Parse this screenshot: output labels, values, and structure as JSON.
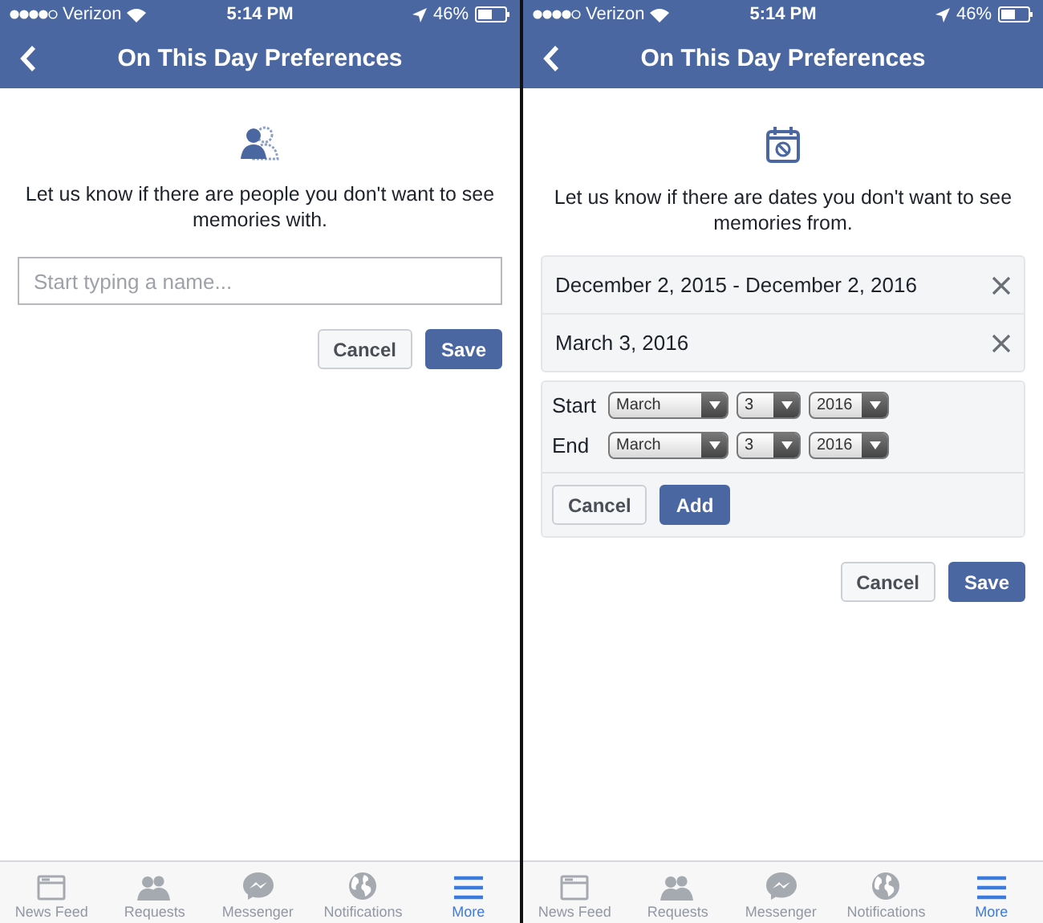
{
  "screens": [
    {
      "status_bar": {
        "carrier": "Verizon",
        "time": "5:14 PM",
        "battery": "46%"
      },
      "header": {
        "title": "On This Day Preferences"
      },
      "kind": "people",
      "intro": "Let us know if there are people you don't want to see memories with.",
      "name_field": {
        "placeholder": "Start typing a name..."
      },
      "buttons": [
        {
          "label": "Cancel",
          "primary": false
        },
        {
          "label": "Save",
          "primary": true
        }
      ],
      "tab_bar": [
        {
          "label": "News Feed",
          "kind": "feed",
          "selected": false
        },
        {
          "label": "Requests",
          "kind": "people",
          "selected": false
        },
        {
          "label": "Messenger",
          "kind": "messenger",
          "selected": false
        },
        {
          "label": "Notifications",
          "kind": "globe",
          "selected": false
        },
        {
          "label": "More",
          "kind": "menu",
          "selected": true
        }
      ]
    },
    {
      "status_bar": {
        "carrier": "Verizon",
        "time": "5:14 PM",
        "battery": "46%"
      },
      "header": {
        "title": "On This Day Preferences"
      },
      "kind": "calendar",
      "intro": "Let us know if there are dates you don't want to see memories from.",
      "date_ranges": [
        {
          "label": "December 2, 2015 - December 2, 2016"
        },
        {
          "label": "March 3, 2016"
        }
      ],
      "picker": {
        "rows": [
          {
            "label": "Start",
            "month": "March",
            "day": "3",
            "year": "2016"
          },
          {
            "label": "End",
            "month": "March",
            "day": "3",
            "year": "2016"
          }
        ],
        "buttons": [
          {
            "label": "Cancel",
            "primary": false
          },
          {
            "label": "Add",
            "primary": true
          }
        ]
      },
      "buttons": [
        {
          "label": "Cancel",
          "primary": false
        },
        {
          "label": "Save",
          "primary": true
        }
      ],
      "tab_bar": [
        {
          "label": "News Feed",
          "kind": "feed",
          "selected": false
        },
        {
          "label": "Requests",
          "kind": "people",
          "selected": false
        },
        {
          "label": "Messenger",
          "kind": "messenger",
          "selected": false
        },
        {
          "label": "Notifications",
          "kind": "globe",
          "selected": false
        },
        {
          "label": "More",
          "kind": "menu",
          "selected": true
        }
      ]
    }
  ]
}
